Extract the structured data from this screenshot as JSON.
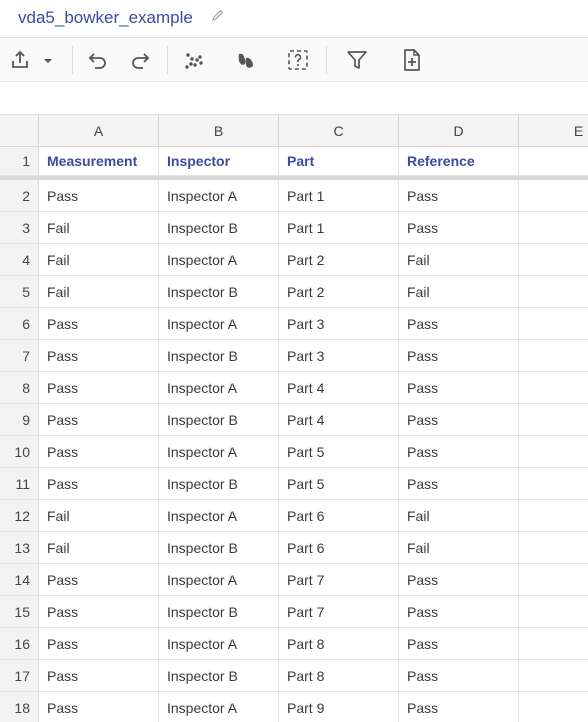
{
  "document": {
    "title": "vda5_bowker_example"
  },
  "toolbar": {
    "buttons": [
      "upload-icon",
      "chevron-down-icon",
      "undo-icon",
      "redo-icon",
      "scatter-icon",
      "steps-icon",
      "help-box-icon",
      "filter-icon",
      "add-file-icon"
    ]
  },
  "sheet": {
    "columns": [
      "A",
      "B",
      "C",
      "D",
      "E"
    ],
    "header_row": {
      "num": "1",
      "cells": [
        "Measurement",
        "Inspector",
        "Part",
        "Reference"
      ]
    },
    "rows": [
      {
        "num": "2",
        "cells": [
          "Pass",
          "Inspector A",
          "Part 1",
          "Pass"
        ]
      },
      {
        "num": "3",
        "cells": [
          "Fail",
          "Inspector B",
          "Part 1",
          "Pass"
        ]
      },
      {
        "num": "4",
        "cells": [
          "Fail",
          "Inspector A",
          "Part 2",
          "Fail"
        ]
      },
      {
        "num": "5",
        "cells": [
          "Fail",
          "Inspector B",
          "Part 2",
          "Fail"
        ]
      },
      {
        "num": "6",
        "cells": [
          "Pass",
          "Inspector A",
          "Part 3",
          "Pass"
        ]
      },
      {
        "num": "7",
        "cells": [
          "Pass",
          "Inspector B",
          "Part 3",
          "Pass"
        ]
      },
      {
        "num": "8",
        "cells": [
          "Pass",
          "Inspector A",
          "Part 4",
          "Pass"
        ]
      },
      {
        "num": "9",
        "cells": [
          "Pass",
          "Inspector B",
          "Part 4",
          "Pass"
        ]
      },
      {
        "num": "10",
        "cells": [
          "Pass",
          "Inspector A",
          "Part 5",
          "Pass"
        ]
      },
      {
        "num": "11",
        "cells": [
          "Pass",
          "Inspector B",
          "Part 5",
          "Pass"
        ]
      },
      {
        "num": "12",
        "cells": [
          "Fail",
          "Inspector A",
          "Part 6",
          "Fail"
        ]
      },
      {
        "num": "13",
        "cells": [
          "Fail",
          "Inspector B",
          "Part 6",
          "Fail"
        ]
      },
      {
        "num": "14",
        "cells": [
          "Pass",
          "Inspector A",
          "Part 7",
          "Pass"
        ]
      },
      {
        "num": "15",
        "cells": [
          "Pass",
          "Inspector B",
          "Part 7",
          "Pass"
        ]
      },
      {
        "num": "16",
        "cells": [
          "Pass",
          "Inspector A",
          "Part 8",
          "Pass"
        ]
      },
      {
        "num": "17",
        "cells": [
          "Pass",
          "Inspector B",
          "Part 8",
          "Pass"
        ]
      },
      {
        "num": "18",
        "cells": [
          "Pass",
          "Inspector A",
          "Part 9",
          "Pass"
        ]
      }
    ]
  },
  "colors": {
    "accent": "#3b4ba0",
    "header_bg": "#f3f3f3",
    "grid_line": "#e2e2e2"
  }
}
